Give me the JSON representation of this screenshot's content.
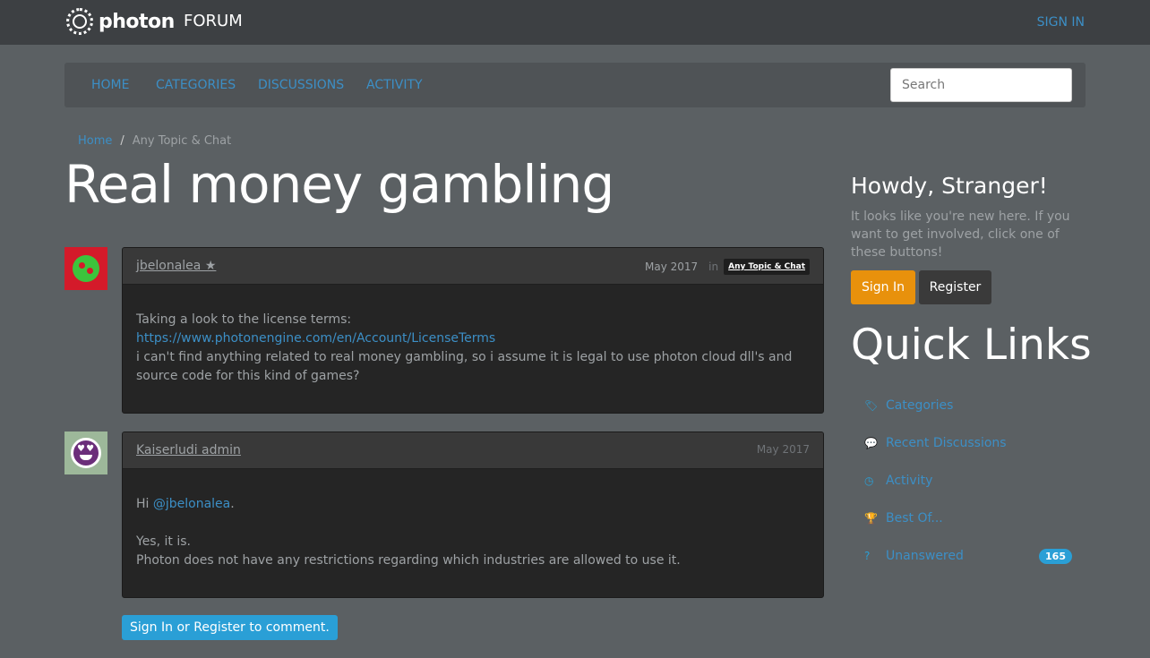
{
  "header": {
    "brand": "photon",
    "forum": "FORUM",
    "sign_in": "SIGN IN"
  },
  "nav": {
    "items": [
      "HOME",
      "CATEGORIES",
      "DISCUSSIONS",
      "ACTIVITY"
    ],
    "search_placeholder": "Search"
  },
  "breadcrumb": {
    "home": "Home",
    "separator": "/",
    "current": "Any Topic & Chat"
  },
  "discussion": {
    "title": "Real money gambling",
    "posts": [
      {
        "author": "jbelonalea ★",
        "date": "May 2017",
        "in_label": "in",
        "category": "Any Topic & Chat",
        "lines": [
          "Taking a look to the license terms:",
          "https://www.photonengine.com/en/Account/LicenseTerms",
          "i can't find anything related to real money gambling, so i assume it is legal to use photon cloud dll's and source code for this kind of games?"
        ]
      },
      {
        "author": "Kaiserludi admin",
        "date": "May 2017",
        "greeting": "Hi",
        "mention": "@jbelonalea",
        "mention_suffix": ".",
        "lines": [
          "Yes, it is.",
          "Photon does not have any restrictions regarding which industries are allowed to use it."
        ]
      }
    ],
    "comment_prompt": {
      "sign_in": "Sign In",
      "or": "or",
      "register": "Register",
      "suffix": "to comment."
    }
  },
  "sidebar": {
    "greeting": "Howdy, Stranger!",
    "intro": "It looks like you're new here. If you want to get involved, click one of these buttons!",
    "sign_in_button": "Sign In",
    "register_button": "Register",
    "quick_links_title": "Quick Links",
    "quick_links": [
      {
        "label": "Categories",
        "icon": "tags-icon",
        "glyph": "🏷"
      },
      {
        "label": "Recent Discussions",
        "icon": "comments-icon",
        "glyph": "💬"
      },
      {
        "label": "Activity",
        "icon": "clock-icon",
        "glyph": "◷"
      },
      {
        "label": "Best Of...",
        "icon": "trophy-icon",
        "glyph": "🏆"
      },
      {
        "label": "Unanswered",
        "icon": "question-icon",
        "glyph": "?",
        "badge": "165"
      }
    ]
  },
  "colors": {
    "accent": "#2a9fd6",
    "link": "#3c8fc6",
    "warning": "#e8910c",
    "background": "#5b6063",
    "topbar": "#3d4043"
  }
}
